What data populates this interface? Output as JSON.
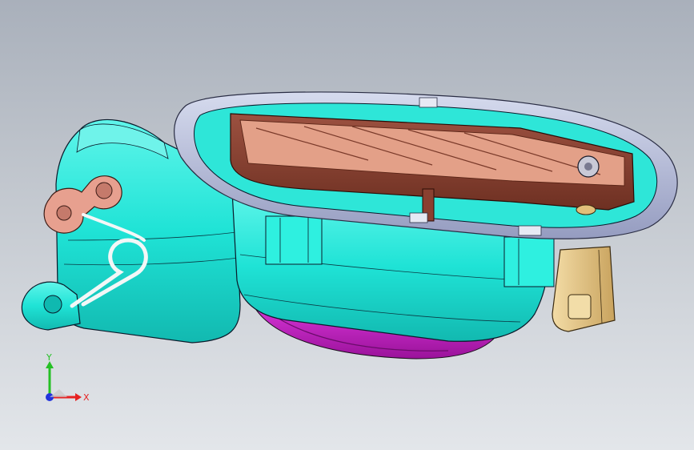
{
  "viewport": {
    "background_top": "#a9b0bb",
    "background_bottom": "#e3e6ea"
  },
  "model": {
    "colors": {
      "housing": "#1fe3d6",
      "housing_shade": "#0fb9b0",
      "bracket": "#e8a090",
      "cover_rim": "#b3b9d6",
      "fan_blades": "#e3a088",
      "frame_dark": "#7a3a2a",
      "base": "#c81ec8",
      "connector": "#e9c98a",
      "edge": "#0a1a2a"
    }
  },
  "triad": {
    "y_label": "Y",
    "x_label": "X",
    "y_color": "#25c025",
    "x_color": "#e62222",
    "z_color": "#2233dd",
    "origin_icon": "coordinate-triad-icon"
  }
}
